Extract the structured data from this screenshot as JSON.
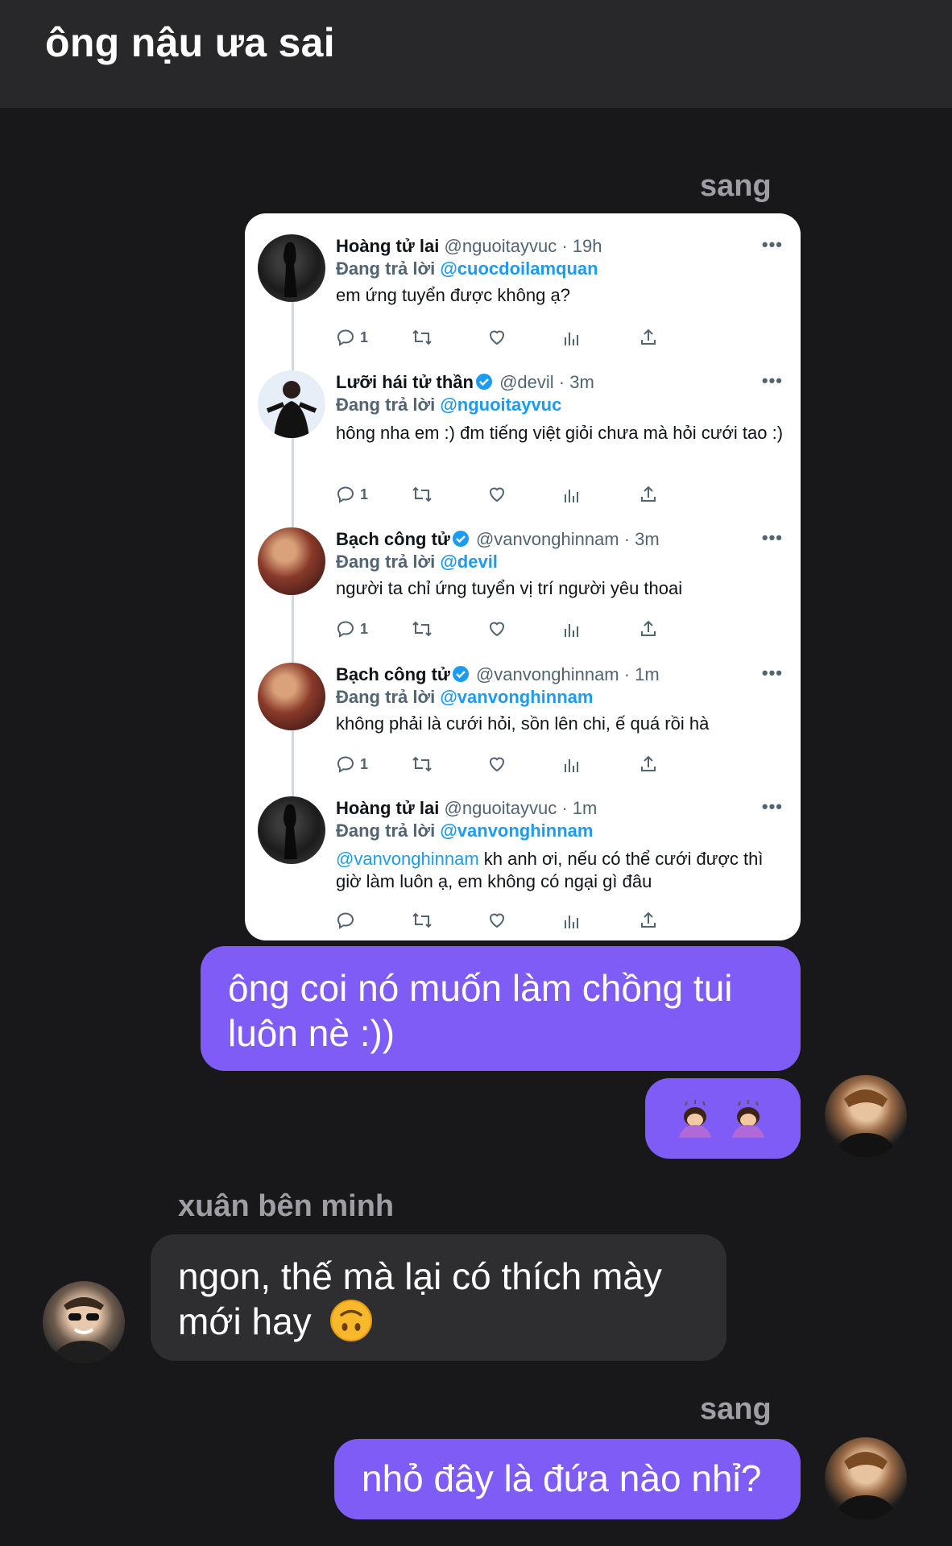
{
  "header": {
    "title": "ông nậu ưa sai"
  },
  "colors": {
    "outgoing_bubble": "#7f5cf6",
    "incoming_bubble": "#2e2e31",
    "background": "#18181a",
    "mention": "#1d9bf0"
  },
  "messages": {
    "sender_sang_1": "sang",
    "msg1": "ông coi nó muốn làm chồng tui luôn nè :))",
    "msg2_emojis": [
      "woman-bowing-emoji",
      "woman-bowing-emoji"
    ],
    "sender_xuan": "xuân bên minh",
    "msg3": "ngon, thế mà lại có thích mày mới hay",
    "msg3_emoji": "upside-down-face-emoji",
    "sender_sang_2": "sang",
    "msg4": "nhỏ đây là đứa nào nhỉ?"
  },
  "tweets": [
    {
      "name": "Hoàng tử lai",
      "verified": false,
      "handle": "@nguoitayvuc · 19h",
      "reply_prefix": "Đang trả lời ",
      "reply_to": "@cuocdoilamquan",
      "text": "em ứng tuyển được không ạ?",
      "replies": "1"
    },
    {
      "name": "Lưỡi hái tử thần",
      "verified": true,
      "handle": "@devil · 3m",
      "reply_prefix": "Đang trả lời ",
      "reply_to": "@nguoitayvuc",
      "text": "hông nha em :) đm tiếng việt giỏi chưa mà hỏi cưới tao :)",
      "replies": "1"
    },
    {
      "name": "Bạch công tử",
      "verified": true,
      "handle": "@vanvonghinnam · 3m",
      "reply_prefix": "Đang trả lời ",
      "reply_to": "@devil",
      "text": "người ta chỉ ứng tuyển vị trí người yêu thoai",
      "replies": "1"
    },
    {
      "name": "Bạch công tử",
      "verified": true,
      "handle": "@vanvonghinnam · 1m",
      "reply_prefix": "Đang trả lời ",
      "reply_to": "@vanvonghinnam",
      "text": "không phải là cưới hỏi, sồn lên chi, ế quá rồi hà",
      "replies": "1"
    },
    {
      "name": "Hoàng tử lai",
      "verified": false,
      "handle": "@nguoitayvuc · 1m",
      "reply_prefix": "Đang trả lời ",
      "reply_to": "@vanvonghinnam",
      "mention": "@vanvonghinnam",
      "text": " kh anh ơi, nếu có thể cưới được thì giờ làm luôn ạ, em không có ngại gì đâu",
      "replies": ""
    }
  ]
}
